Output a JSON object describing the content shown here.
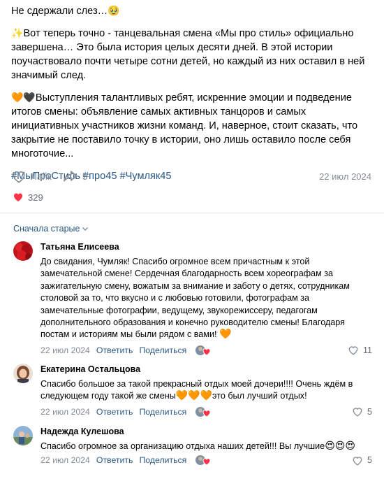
{
  "post": {
    "title": "Не сдержали слез…",
    "title_emoji": "🥹",
    "p1_emoji": "✨",
    "p1": "Вот теперь точно - танцевальная смена «Мы про стиль» официально завершена… Это была история целых десяти дней. В этой истории поучаствовало почти четыре сотни детей, но каждый из них оставил в ней значимый след.",
    "p2_emoji": "🧡🖤",
    "p2": "Выступления талантливых ребят, искренние эмоции и подведение итогов смены: объявление самых активных танцоров и самых инициативных участников жизни команд. И, наверное, стоит сказать, что закрытие не поставило точку в истории, оно лишь оставило после себя многоточие...",
    "hashtags": [
      "#МыПроСтиль",
      "#про45",
      "#Чумляк45"
    ]
  },
  "actions": {
    "like_label": "Лайк",
    "share_count": "5",
    "date": "22 июл 2024"
  },
  "reactions": {
    "count": "329"
  },
  "comments_header": {
    "sort_label": "Сначала старые"
  },
  "comments": [
    {
      "name": "Татьяна Елисеева",
      "text": "До свидания, Чумляк! Спасибо огромное всем причастным к этой замечательной смене! Сердечная благодарность всем хореографам за зажигательную смену, вожатым за внимание и заботу о детях, сотрудникам столовой за то, что вкусно и с любовью готовили, фотографам за замечательные фотографии, ведущему, звукорежиссеру, педагогам дополнительного образования и конечно руководителю смены! Благодаря постам и историям мы были рядом с вами!",
      "text_emoji": "🧡",
      "date": "22 июл 2024",
      "reply_label": "Ответить",
      "share_label": "Поделиться",
      "likes": "11"
    },
    {
      "name": "Екатерина Остальцова",
      "text_a": "Спасибо большое за такой прекрасный отдых моей дочери!!!! Очень ждём в следующем году такой же смены",
      "text_emoji": "🧡🧡🧡",
      "text_b": "это был лучший отдых!",
      "date": "22 июл 2024",
      "reply_label": "Ответить",
      "share_label": "Поделиться",
      "likes": "5"
    },
    {
      "name": "Надежда Кулешова",
      "text": "Спасибо огромное за организацию отдыха наших детей!!! Вы лучшие",
      "text_emoji": "😍😍😍",
      "date": "22 июл 2024",
      "reply_label": "Ответить",
      "share_label": "Поделиться",
      "likes": "5"
    }
  ],
  "colors": {
    "link": "#2a5885",
    "muted": "#818c99",
    "like_red": "#ff3347",
    "divider": "#e7e8ec"
  }
}
